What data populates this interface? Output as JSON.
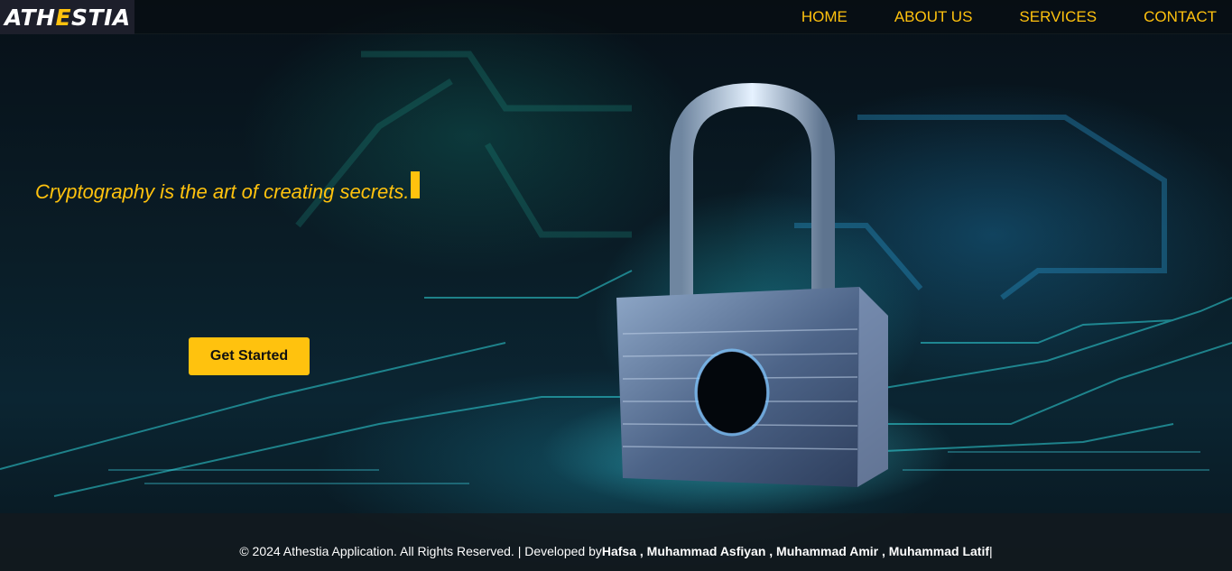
{
  "brand": {
    "logo_part1": "ATH",
    "logo_accent": "E",
    "logo_part2": "STIA"
  },
  "nav": {
    "home": "HOME",
    "about": "ABOUT US",
    "services": "SERVICES",
    "contact": "CONTACT"
  },
  "hero": {
    "tagline": "Cryptography is the art of creating secrets.",
    "cta_label": "Get Started"
  },
  "footer": {
    "copyright": "© 2024 Athestia Application. All Rights Reserved. | Developed by ",
    "developers": "Hafsa , Muhammad Asfiyan , Muhammad Amir , Muhammad Latif",
    "trailing": " |"
  },
  "colors": {
    "accent": "#ffc20e",
    "logo_bg": "#1d1f2b",
    "footer_bg": "#141a1e"
  }
}
